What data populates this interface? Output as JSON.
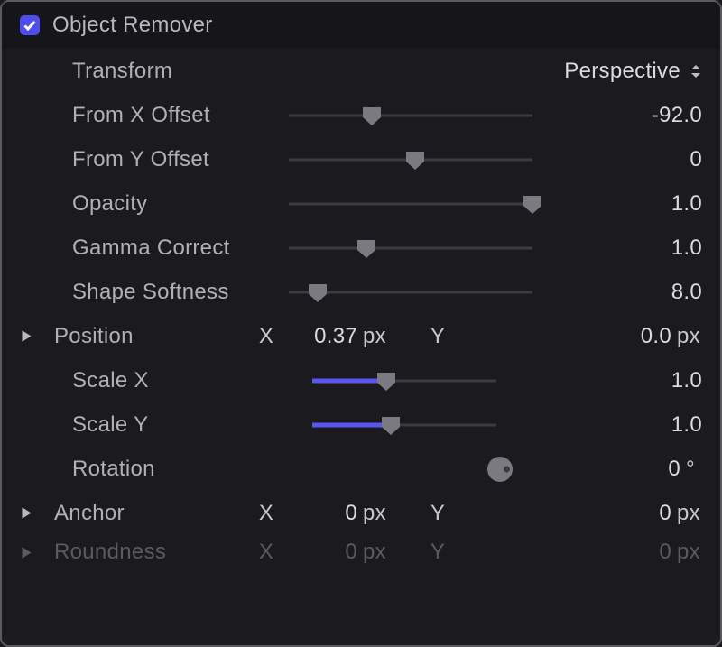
{
  "header": {
    "title": "Object Remover"
  },
  "transform": {
    "label": "Transform",
    "value": "Perspective"
  },
  "fromX": {
    "label": "From X Offset",
    "value": "-92.0",
    "pct": 34
  },
  "fromY": {
    "label": "From Y Offset",
    "value": "0",
    "pct": 52
  },
  "opacity": {
    "label": "Opacity",
    "value": "1.0",
    "pct": 100
  },
  "gamma": {
    "label": "Gamma Correct",
    "value": "1.0",
    "pct": 32
  },
  "softness": {
    "label": "Shape Softness",
    "value": "8.0",
    "pct": 12
  },
  "position": {
    "label": "Position",
    "xlabel": "X",
    "xval": "0.37",
    "xunit": "px",
    "ylabel": "Y",
    "yval": "0.0",
    "yunit": "px"
  },
  "scaleX": {
    "label": "Scale X",
    "value": "1.0",
    "pct": 47
  },
  "scaleY": {
    "label": "Scale Y",
    "value": "1.0",
    "pct": 49
  },
  "rotation": {
    "label": "Rotation",
    "value": "0",
    "unit": "°"
  },
  "anchor": {
    "label": "Anchor",
    "xlabel": "X",
    "xval": "0",
    "xunit": "px",
    "ylabel": "Y",
    "yval": "0",
    "yunit": "px"
  },
  "roundness": {
    "label": "Roundness",
    "xlabel": "X",
    "xval": "0",
    "xunit": "px",
    "ylabel": "Y",
    "yval": "0",
    "yunit": "px"
  }
}
